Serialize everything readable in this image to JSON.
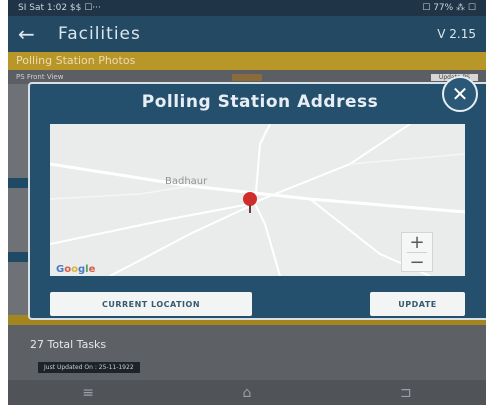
{
  "status_bar": {
    "left": "SI Sat 1:02 $$ ☐···",
    "right": "☐ 77% ⁂ ☐"
  },
  "app_bar": {
    "back_icon": "←",
    "title": "Facilities",
    "version": "V 2.15"
  },
  "section": {
    "title": "Polling Station Photos"
  },
  "background": {
    "row_label": "PS Front View",
    "row_button": "Update PS",
    "total_tasks": "27 Total Tasks",
    "updated": "Just Updated On : 25-11-1922"
  },
  "dialog": {
    "title": "Polling Station Address",
    "close_icon": "✕",
    "map": {
      "place_label": "Badhaur",
      "zoom_in": "+",
      "zoom_out": "−",
      "logo_letters": [
        "G",
        "o",
        "o",
        "g",
        "l",
        "e"
      ]
    },
    "current_location_label": "CURRENT LOCATION",
    "update_label": "UPDATE"
  },
  "nav": {
    "menu_icon": "≡",
    "home_icon": "⌂",
    "back_icon": "⊐"
  },
  "colors": {
    "primary": "#244f6d",
    "accent": "#b99628",
    "pin": "#cf2c2c"
  }
}
